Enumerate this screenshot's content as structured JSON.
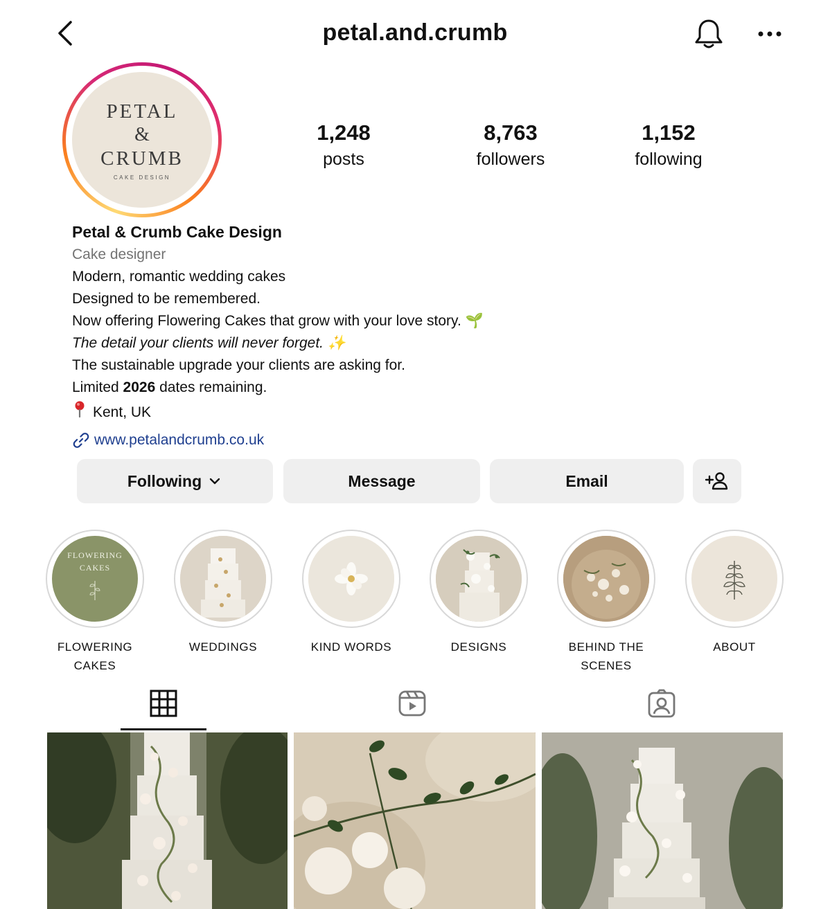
{
  "header": {
    "username": "petal.and.crumb"
  },
  "avatar": {
    "logo_line1": "PETAL",
    "logo_amp": "&",
    "logo_line2": "CRUMB",
    "logo_sub": "CAKE DESIGN"
  },
  "stats": {
    "posts_count": "1,248",
    "posts_label": "posts",
    "followers_count": "8,763",
    "followers_label": "followers",
    "following_count": "1,152",
    "following_label": "following"
  },
  "bio": {
    "name": "Petal & Crumb Cake Design",
    "category": "Cake designer",
    "line1": "Modern, romantic wedding cakes",
    "line2": "Designed to be remembered.",
    "line3": "Now offering Flowering Cakes that grow with your love story. 🌱",
    "line4": "The detail your clients will never forget. ✨",
    "line5": "The sustainable upgrade your clients are asking for.",
    "line6_pre": "Limited ",
    "line6_bold": "2026",
    "line6_post": " dates remaining.",
    "location": "Kent, UK",
    "website": "www.petalandcrumb.co.uk"
  },
  "actions": {
    "following_label": "Following",
    "message_label": "Message",
    "email_label": "Email"
  },
  "highlights": [
    {
      "label": "FLOWERING CAKES",
      "cover_text": "FLOWERING CAKES"
    },
    {
      "label": "WEDDINGS"
    },
    {
      "label": "KIND WORDS"
    },
    {
      "label": "DESIGNS"
    },
    {
      "label": "BEHIND THE SCENES"
    },
    {
      "label": "ABOUT"
    }
  ],
  "tabs": [
    {
      "icon": "grid-icon",
      "active": true
    },
    {
      "icon": "reels-icon",
      "active": false
    },
    {
      "icon": "tagged-icon",
      "active": false
    }
  ],
  "colors": {
    "link": "#1f3f8f",
    "button_bg": "#efefef",
    "story_ring_start": "#fa7e1e",
    "story_ring_end": "#d62976",
    "highlight_green": "#8a9468"
  }
}
